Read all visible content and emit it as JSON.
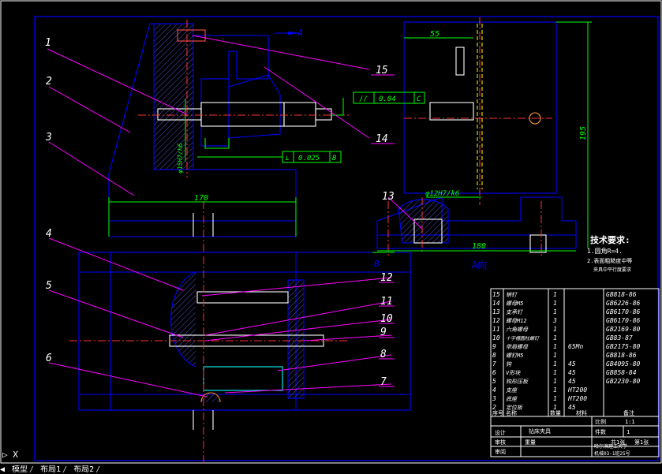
{
  "drawing": {
    "section_marker": "A",
    "view_title": "A向",
    "dims": {
      "width_170": "170",
      "width_180": "180",
      "width_55": "55",
      "height_195": "195",
      "bore_fit": "φ12H7/k6",
      "bore_fit_vertical": "φ15H7/h6"
    },
    "tolerance_frames": [
      {
        "symbol": "//",
        "value": "0.04",
        "datum": "C"
      },
      {
        "symbol": "⊥",
        "value": "0.025",
        "datum": "B"
      }
    ],
    "datum_b": "B",
    "balloons": [
      "1",
      "2",
      "3",
      "4",
      "5",
      "6",
      "7",
      "8",
      "9",
      "10",
      "11",
      "12",
      "13",
      "14",
      "15"
    ]
  },
  "tech_requirements": {
    "title": "技术要求:",
    "lines": [
      "1.圆角R=4.",
      "2.表面粗糙度中等",
      "夹具中平行度要求"
    ]
  },
  "bom": {
    "rows": [
      {
        "no": "15",
        "name": "销钉",
        "qty": "1",
        "mat": "",
        "std": "GB818-86"
      },
      {
        "no": "14",
        "name": "螺母M5",
        "qty": "1",
        "mat": "",
        "std": "GB6226-86"
      },
      {
        "no": "13",
        "name": "支承钉",
        "qty": "1",
        "mat": "",
        "std": "GB6170-86"
      },
      {
        "no": "12",
        "name": "螺母M12",
        "qty": "3",
        "mat": "",
        "std": "GB6170-86"
      },
      {
        "no": "11",
        "name": "六角螺母",
        "qty": "1",
        "mat": "",
        "std": "GB2169-80"
      },
      {
        "no": "10",
        "name": "十字槽圆柱螺钉",
        "qty": "1",
        "mat": "",
        "std": "GB83-87"
      },
      {
        "no": "9",
        "name": "带肩螺母",
        "qty": "1",
        "mat": "65Mn",
        "std": "GB2175-80"
      },
      {
        "no": "8",
        "name": "螺钉M5",
        "qty": "1",
        "mat": "",
        "std": "GB818-86"
      },
      {
        "no": "7",
        "name": "钩",
        "qty": "1",
        "mat": "45",
        "std": "GB4095-80"
      },
      {
        "no": "6",
        "name": "V形块",
        "qty": "1",
        "mat": "45",
        "std": "GB858-84"
      },
      {
        "no": "5",
        "name": "钩形压板",
        "qty": "1",
        "mat": "45",
        "std": "GB2230-80"
      },
      {
        "no": "4",
        "name": "支座",
        "qty": "1",
        "mat": "HT200",
        "std": ""
      },
      {
        "no": "3",
        "name": "底座",
        "qty": "1",
        "mat": "HT200",
        "std": ""
      },
      {
        "no": "2",
        "name": "定位板",
        "qty": "1",
        "mat": "45",
        "std": ""
      }
    ],
    "header": {
      "no": "序号",
      "name": "名称",
      "qty": "数量",
      "mat": "材料",
      "std": "备注"
    }
  },
  "title_block": {
    "drawing_name": "钻床夹具",
    "scale_label": "比例",
    "scale": "1:1",
    "count_label": "件数",
    "count": "1",
    "weight_label": "重量",
    "sheet_label": "共1张",
    "sheet_no": "第1张",
    "designer_label": "设计",
    "checker_label": "审核",
    "reviewer_label": "审阅",
    "school": "哈尔滨理工大学",
    "class_code": "机械03-1班25号"
  },
  "command_prompt": "▷ X",
  "tabs": [
    "模型",
    "布局1",
    "布局2"
  ]
}
